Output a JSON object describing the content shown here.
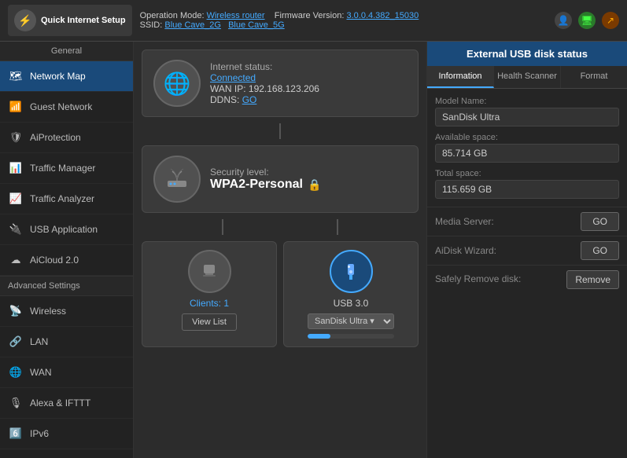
{
  "topbar": {
    "logo_label": "Quick Internet Setup",
    "operation_mode_prefix": "Operation Mode:",
    "operation_mode": "Wireless router",
    "firmware_prefix": "Firmware Version:",
    "firmware": "3.0.0.4.382_15030",
    "ssid_prefix": "SSID:",
    "ssid1": "Blue Cave_2G",
    "ssid2": "Blue Cave_5G",
    "icon_user": "👤",
    "icon_monitor": "🖥",
    "icon_share": "↗"
  },
  "sidebar": {
    "general_title": "General",
    "items": [
      {
        "id": "network-map",
        "label": "Network Map",
        "icon": "🗺",
        "active": true
      },
      {
        "id": "guest-network",
        "label": "Guest Network",
        "icon": "📶",
        "active": false
      },
      {
        "id": "aiprotection",
        "label": "AiProtection",
        "icon": "🛡",
        "active": false
      },
      {
        "id": "traffic-manager",
        "label": "Traffic Manager",
        "icon": "📊",
        "active": false
      },
      {
        "id": "traffic-analyzer",
        "label": "Traffic Analyzer",
        "icon": "📈",
        "active": false
      },
      {
        "id": "usb-application",
        "label": "USB Application",
        "icon": "🔌",
        "active": false
      },
      {
        "id": "aicloud",
        "label": "AiCloud 2.0",
        "icon": "☁",
        "active": false
      }
    ],
    "advanced_title": "Advanced Settings",
    "advanced_items": [
      {
        "id": "wireless",
        "label": "Wireless",
        "icon": "📡",
        "active": false
      },
      {
        "id": "lan",
        "label": "LAN",
        "icon": "🔗",
        "active": false
      },
      {
        "id": "wan",
        "label": "WAN",
        "icon": "🌐",
        "active": false
      },
      {
        "id": "alexa",
        "label": "Alexa & IFTTT",
        "icon": "🎙",
        "active": false
      },
      {
        "id": "ipv6",
        "label": "IPv6",
        "icon": "6️⃣",
        "active": false
      }
    ]
  },
  "network_map": {
    "internet_status_label": "Internet status:",
    "connected_label": "Connected",
    "wan_ip_label": "WAN IP: 192.168.123.206",
    "ddns_label": "DDNS:",
    "ddns_go": "GO",
    "security_level_label": "Security level:",
    "security_value": "WPA2-Personal",
    "clients_label": "Clients:",
    "clients_count": "1",
    "view_list_label": "View List",
    "usb_label": "USB 3.0",
    "usb_disk": "SanDisk Ultra"
  },
  "usb_panel": {
    "title": "External USB disk status",
    "tab_information": "Information",
    "tab_health": "Health Scanner",
    "tab_format": "Format",
    "model_name_label": "Model Name:",
    "model_name_value": "SanDisk Ultra",
    "available_space_label": "Available space:",
    "available_space_value": "85.714 GB",
    "total_space_label": "Total space:",
    "total_space_value": "115.659 GB",
    "media_server_label": "Media Server:",
    "media_server_go": "GO",
    "aidisk_label": "AiDisk Wizard:",
    "aidisk_go": "GO",
    "safely_remove_label": "Safely Remove disk:",
    "safely_remove_btn": "Remove"
  }
}
